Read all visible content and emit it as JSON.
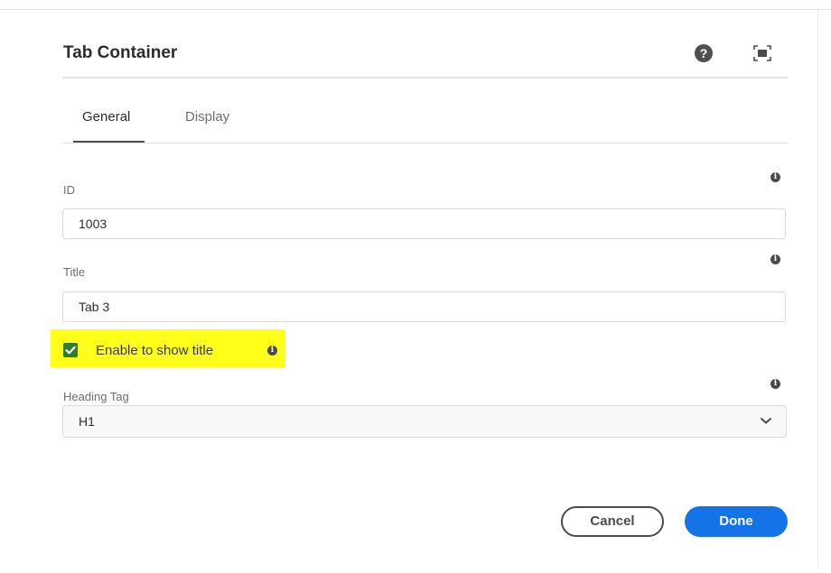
{
  "dialog": {
    "title": "Tab Container",
    "help_icon_glyph": "?",
    "help_icon": "help-icon",
    "fullscreen_icon": "fullscreen-icon"
  },
  "tabs": [
    {
      "label": "General",
      "selected": true
    },
    {
      "label": "Display",
      "selected": false
    }
  ],
  "fields": {
    "id": {
      "label": "ID",
      "value": "1003"
    },
    "title": {
      "label": "Title",
      "value": "Tab 3"
    },
    "show_title": {
      "label": "Enable to show title",
      "checked": true
    },
    "heading_tag": {
      "label": "Heading Tag",
      "value": "H1"
    }
  },
  "info_icon_glyph": "i",
  "buttons": {
    "cancel": "Cancel",
    "done": "Done"
  },
  "colors": {
    "accent": "#1473e6",
    "highlight": "#ffff1a",
    "checkbox": "#2d7d2d"
  }
}
